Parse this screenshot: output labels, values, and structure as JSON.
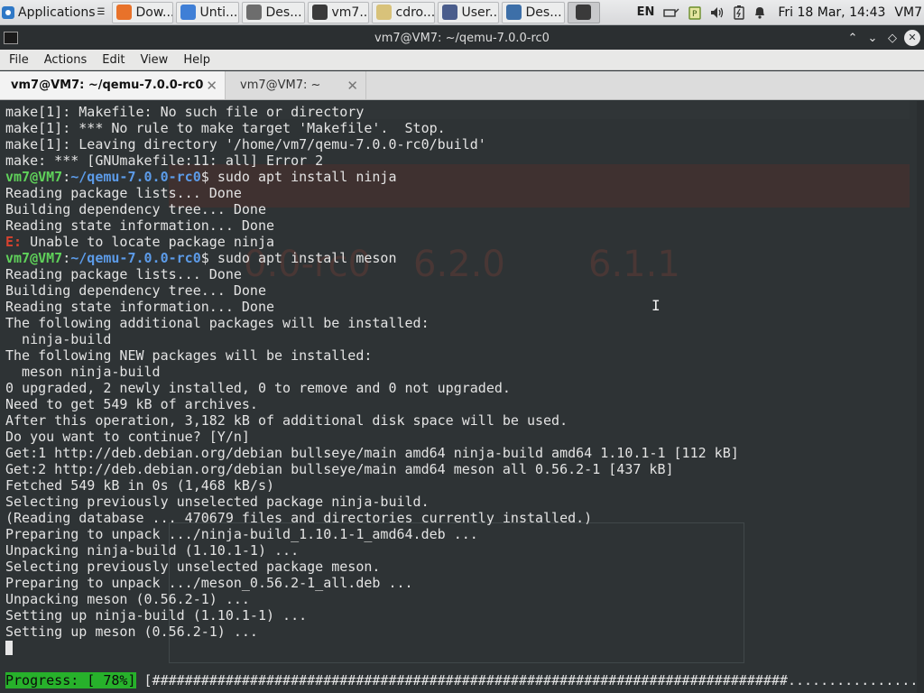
{
  "panel": {
    "applications_label": "Applications",
    "tasks": [
      {
        "label": "Dow...",
        "icon": "firefox-icon",
        "color": "#e8722a"
      },
      {
        "label": "Unti...",
        "icon": "chromium-icon",
        "color": "#3f7fd6"
      },
      {
        "label": "Des...",
        "icon": "document-icon",
        "color": "#6d6d6d"
      },
      {
        "label": "vm7...",
        "icon": "terminal-icon",
        "color": "#3a3a3a"
      },
      {
        "label": "cdro...",
        "icon": "folder-icon",
        "color": "#d8c27a"
      },
      {
        "label": "User...",
        "icon": "settings-icon",
        "color": "#4a5d8c"
      },
      {
        "label": "Des...",
        "icon": "desktop-icon",
        "color": "#3d6fa8"
      }
    ],
    "keyboard_layout": "EN",
    "clock": "Fri 18 Mar, 14:43",
    "hostname": "VM7"
  },
  "window": {
    "title": "vm7@VM7: ~/qemu-7.0.0-rc0"
  },
  "menu": [
    "File",
    "Actions",
    "Edit",
    "View",
    "Help"
  ],
  "tabs": [
    {
      "label": "vm7@VM7: ~/qemu-7.0.0-rc0",
      "active": true
    },
    {
      "label": "vm7@VM7: ~",
      "active": false
    }
  ],
  "terminal": {
    "prompt_user": "vm7@VM7",
    "prompt_path": "~/qemu-7.0.0-rc0",
    "lines": [
      {
        "kind": "out",
        "text": "make[1]: Makefile: No such file or directory"
      },
      {
        "kind": "out",
        "text": "make[1]: *** No rule to make target 'Makefile'.  Stop."
      },
      {
        "kind": "out",
        "text": "make[1]: Leaving directory '/home/vm7/qemu-7.0.0-rc0/build'"
      },
      {
        "kind": "out",
        "text": "make: *** [GNUmakefile:11: all] Error 2"
      },
      {
        "kind": "cmd",
        "text": "sudo apt install ninja"
      },
      {
        "kind": "out",
        "text": "Reading package lists... Done"
      },
      {
        "kind": "out",
        "text": "Building dependency tree... Done"
      },
      {
        "kind": "out",
        "text": "Reading state information... Done"
      },
      {
        "kind": "err",
        "prefix": "E:",
        "text": " Unable to locate package ninja"
      },
      {
        "kind": "cmd",
        "text": "sudo apt install meson"
      },
      {
        "kind": "out",
        "text": "Reading package lists... Done"
      },
      {
        "kind": "out",
        "text": "Building dependency tree... Done"
      },
      {
        "kind": "out",
        "text": "Reading state information... Done"
      },
      {
        "kind": "out",
        "text": "The following additional packages will be installed:"
      },
      {
        "kind": "out",
        "text": "  ninja-build"
      },
      {
        "kind": "out",
        "text": "The following NEW packages will be installed:"
      },
      {
        "kind": "out",
        "text": "  meson ninja-build"
      },
      {
        "kind": "out",
        "text": "0 upgraded, 2 newly installed, 0 to remove and 0 not upgraded."
      },
      {
        "kind": "out",
        "text": "Need to get 549 kB of archives."
      },
      {
        "kind": "out",
        "text": "After this operation, 3,182 kB of additional disk space will be used."
      },
      {
        "kind": "out",
        "text": "Do you want to continue? [Y/n]"
      },
      {
        "kind": "out",
        "text": "Get:1 http://deb.debian.org/debian bullseye/main amd64 ninja-build amd64 1.10.1-1 [112 kB]"
      },
      {
        "kind": "out",
        "text": "Get:2 http://deb.debian.org/debian bullseye/main amd64 meson all 0.56.2-1 [437 kB]"
      },
      {
        "kind": "out",
        "text": "Fetched 549 kB in 0s (1,468 kB/s)"
      },
      {
        "kind": "out",
        "text": "Selecting previously unselected package ninja-build."
      },
      {
        "kind": "out",
        "text": "(Reading database ... 470679 files and directories currently installed.)"
      },
      {
        "kind": "out",
        "text": "Preparing to unpack .../ninja-build_1.10.1-1_amd64.deb ..."
      },
      {
        "kind": "out",
        "text": "Unpacking ninja-build (1.10.1-1) ..."
      },
      {
        "kind": "out",
        "text": "Selecting previously unselected package meson."
      },
      {
        "kind": "out",
        "text": "Preparing to unpack .../meson_0.56.2-1_all.deb ..."
      },
      {
        "kind": "out",
        "text": "Unpacking meson (0.56.2-1) ..."
      },
      {
        "kind": "out",
        "text": "Setting up ninja-build (1.10.1-1) ..."
      },
      {
        "kind": "out",
        "text": "Setting up meson (0.56.2-1) ..."
      },
      {
        "kind": "cursor",
        "text": ""
      },
      {
        "kind": "blank",
        "text": ""
      },
      {
        "kind": "progress",
        "label": "Progress: [ 78%]",
        "bar": " [##############################################################################.....................]"
      }
    ],
    "progress_percent": 78
  },
  "colors": {
    "terminal_bg": "#2e3335",
    "prompt_user": "#5fd15a",
    "prompt_path": "#5c9be8",
    "error": "#d7422f",
    "progress_bg": "#27b12b"
  }
}
